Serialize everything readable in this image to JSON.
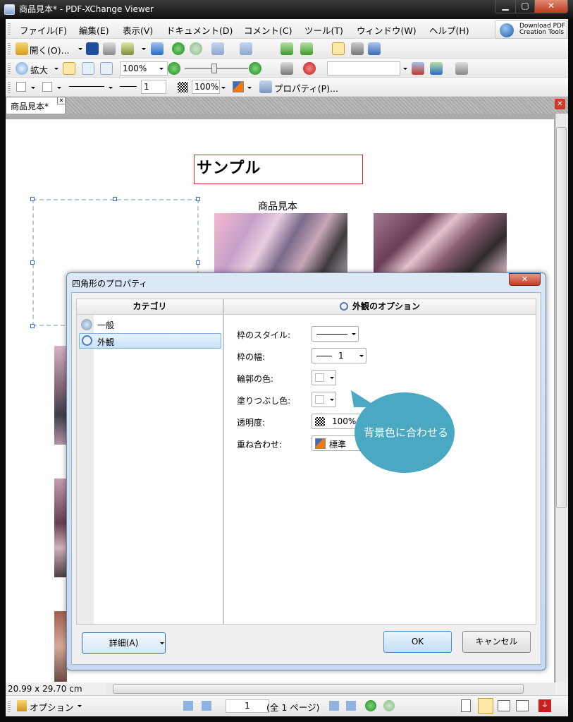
{
  "window": {
    "title": "商品見本* - PDF-XChange Viewer"
  },
  "menubar": {
    "items": [
      "ファイル(F)",
      "編集(E)",
      "表示(V)",
      "ドキュメント(D)",
      "コメント(C)",
      "ツール(T)",
      "ウィンドウ(W)",
      "ヘルプ(H)"
    ]
  },
  "download": {
    "label": "Download PDF Creation Tools"
  },
  "toolbar": {
    "open_label": "開く(O)...",
    "zoom_label": "拡大",
    "zoom_value": "100%",
    "line_width": "1",
    "opacity": "100%",
    "properties_label": "プロパティ(P)..."
  },
  "tab": {
    "label": "商品見本*"
  },
  "document": {
    "title": "サンプル",
    "caption": "商品見本"
  },
  "status": {
    "page_size": "20.99 x 29.70 cm"
  },
  "bottom": {
    "options_label": "オプション",
    "page_number": "1",
    "page_total": "(全 1 ページ)"
  },
  "dialog": {
    "title": "四角形のプロパティ",
    "category_header": "カテゴリ",
    "options_header": "外観のオプション",
    "categories": [
      "一般",
      "外観"
    ],
    "selected_category": "外観",
    "fields": {
      "border_style_label": "枠のスタイル:",
      "border_width_label": "枠の幅:",
      "border_width_value": "1",
      "outline_color_label": "輪郭の色:",
      "fill_color_label": "塗りつぶし色:",
      "opacity_label": "透明度:",
      "opacity_value": "100%",
      "blend_label": "重ね合わせ:",
      "blend_value": "標準"
    },
    "details_button": "詳細(A)",
    "ok_button": "OK",
    "cancel_button": "キャンセル"
  },
  "callout": {
    "text": "背景色に合わせる",
    "color": "#4aa8c2"
  },
  "colors": {
    "accent_red": "#e22222",
    "selection_blue": "#7db2e6"
  }
}
